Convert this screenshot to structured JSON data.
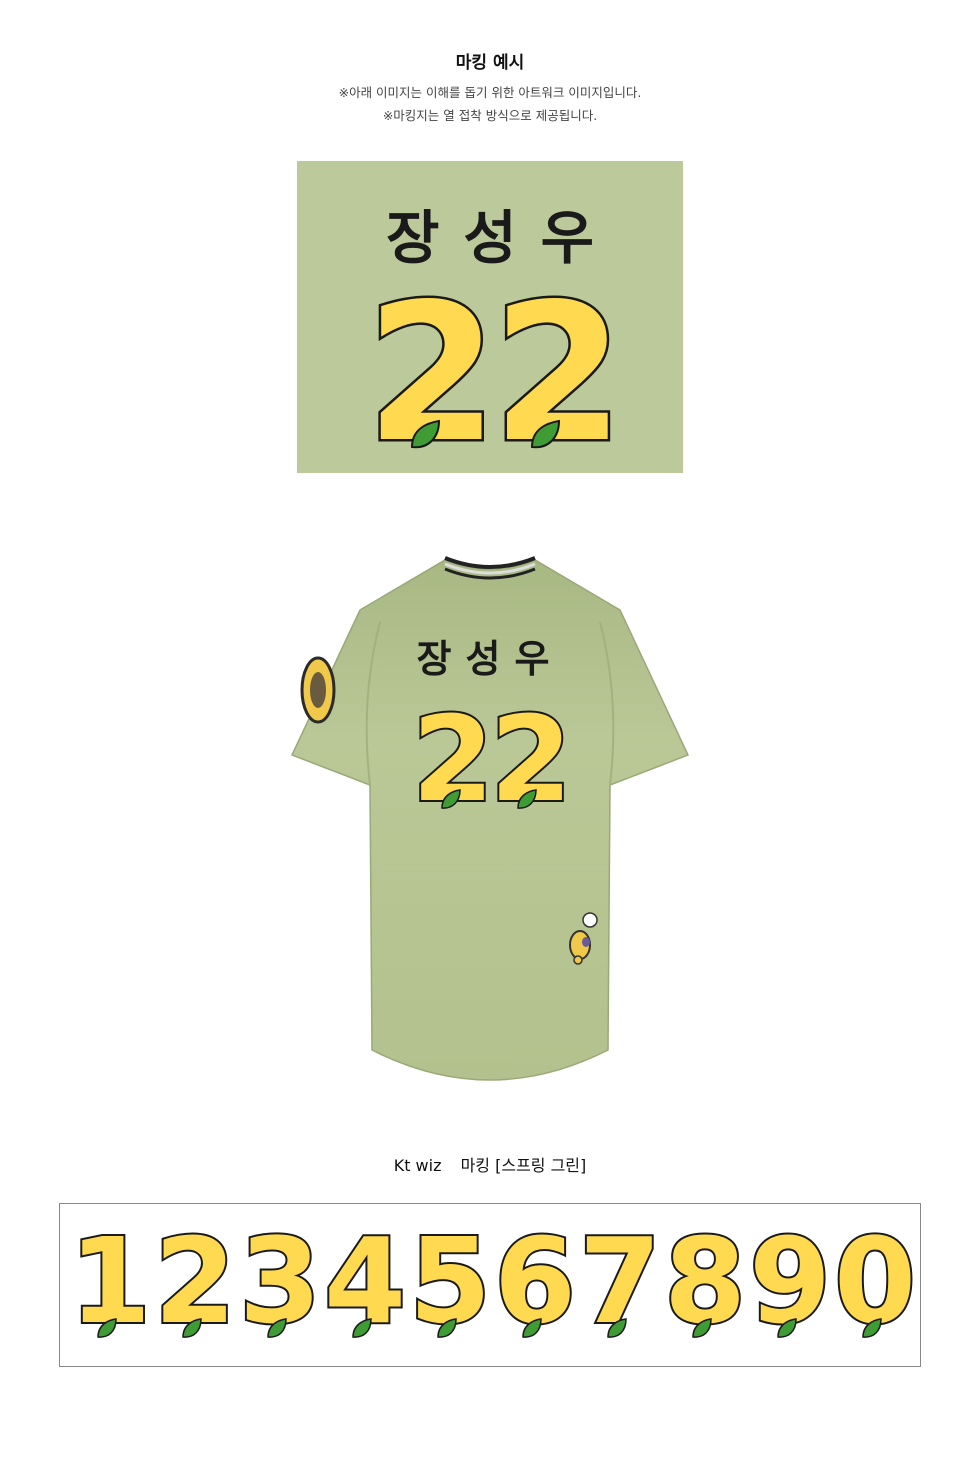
{
  "header": {
    "title": "마킹 예시",
    "note1": "※아래 이미지는 이해를 돕기 위한 아트워크 이미지입니다.",
    "note2": "※마킹지는 열 접착 방식으로 제공됩니다."
  },
  "marking": {
    "name": "장성우",
    "number": "22"
  },
  "caption": {
    "brand": "Kt wiz",
    "label": "마킹 [스프링 그린]"
  },
  "digits": [
    "1",
    "2",
    "3",
    "4",
    "5",
    "6",
    "7",
    "8",
    "9",
    "0"
  ],
  "colors": {
    "jersey": "#b7c594",
    "panel": "#bcc99a",
    "digit_fill": "#ffd94f",
    "digit_outline": "#1a1a1a",
    "leaf": "#3f9c35"
  }
}
